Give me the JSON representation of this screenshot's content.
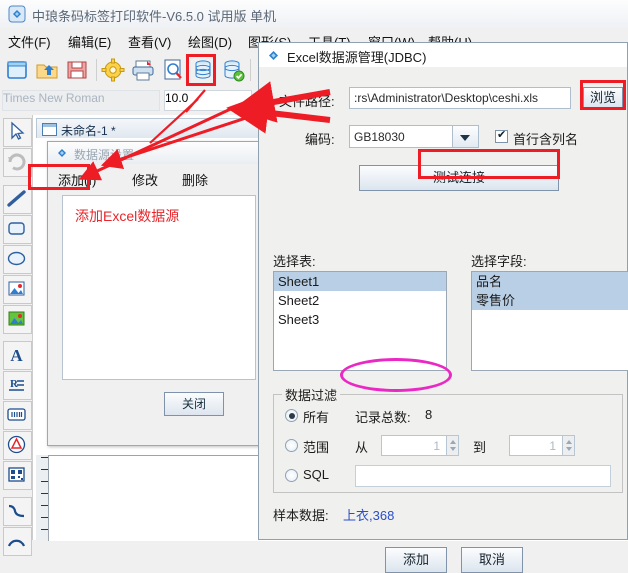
{
  "app": {
    "title": "中琅条码标签打印软件-V6.5.0 试用版 单机",
    "menu": [
      "文件(F)",
      "编辑(E)",
      "查看(V)",
      "绘图(D)",
      "图形(S)",
      "工具(T)",
      "窗口(W)",
      "帮助(H)"
    ],
    "toolbar_icons": [
      "new-document-icon",
      "open-folder-icon",
      "save-icon",
      "settings-gear-icon",
      "print-icon",
      "print-preview-icon",
      "database-icon",
      "database-connected-icon"
    ],
    "font_name": "Times New Roman",
    "font_size": "10.0",
    "document_tab": "未命名-1 *",
    "left_tools": [
      "select-pointer-icon",
      "rotate-icon",
      "line-icon",
      "rounded-rect-icon",
      "ellipse-icon",
      "image-icon",
      "picture-icon",
      "text-icon",
      "richtext-icon",
      "barcode-icon",
      "shape-icon",
      "qrcode-icon",
      "curve-icon",
      "arc-icon"
    ]
  },
  "datasource_dialog": {
    "title": "数据源设置",
    "buttons": [
      "添加(I)",
      "修改",
      "删除"
    ],
    "annotation": "添加Excel数据源",
    "close_label": "关闭"
  },
  "excel_dialog": {
    "title": "Excel数据源管理(JDBC)",
    "file_path_label": "文件路径:",
    "file_path_value": ":rs\\Administrator\\Desktop\\ceshi.xls",
    "browse_label": "浏览",
    "encoding_label": "编码:",
    "encoding_value": "GB18030",
    "header_checkbox_label": "首行含列名",
    "header_checkbox_checked": true,
    "test_connection_label": "测试连接",
    "select_table_label": "选择表:",
    "tables": [
      "Sheet1",
      "Sheet2",
      "Sheet3"
    ],
    "selected_table": "Sheet1",
    "select_field_label": "选择字段:",
    "fields": [
      "品名",
      "零售价"
    ],
    "selected_fields": [
      "品名",
      "零售价"
    ],
    "filter_group_label": "数据过滤",
    "filter_all_label": "所有",
    "record_count_label": "记录总数:",
    "record_count_value": "8",
    "filter_range_label": "范围",
    "range_from_label": "从",
    "range_from_value": "1",
    "range_to_label": "到",
    "range_to_value": "1",
    "filter_sql_label": "SQL",
    "sql_value": "",
    "sample_data_label": "样本数据:",
    "sample_data_value": "上衣,368",
    "add_label": "添加",
    "cancel_label": "取消"
  },
  "colors": {
    "annotation_red": "#ee1c25",
    "annotation_magenta": "#ea29c4",
    "selection_blue": "#b8cfe5",
    "sample_blue": "#2b4ec8"
  }
}
